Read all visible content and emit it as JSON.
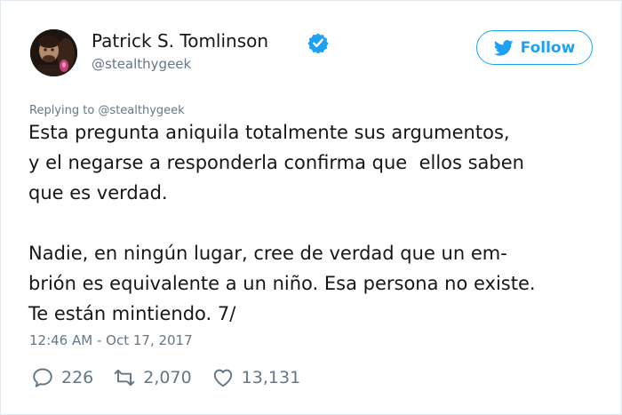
{
  "user": {
    "display_name": "Patrick S. Tomlinson",
    "screen_name": "@stealthygeek",
    "verified": true
  },
  "follow": {
    "label": "Follow",
    "icon": "twitter-bird-icon"
  },
  "reply_context": "Replying to @stealthygeek",
  "tweet": {
    "lines": [
      "Esta pregunta aniquila totalmente sus argumentos,",
      "y el negarse a responderla confirma que  ellos saben",
      "que es verdad.",
      "",
      "Nadie, en ningún lugar, cree de verdad que un em-",
      "brión es equivalente a un niño. Esa persona no existe.",
      "Te están mintiendo. 7/"
    ]
  },
  "timestamp": "12:46 AM - Oct 17, 2017",
  "actions": {
    "replies": "226",
    "retweets": "2,070",
    "likes": "13,131"
  },
  "colors": {
    "brand_blue": "#1da1f2",
    "secondary_text": "#657786",
    "primary_text": "#14171a"
  }
}
